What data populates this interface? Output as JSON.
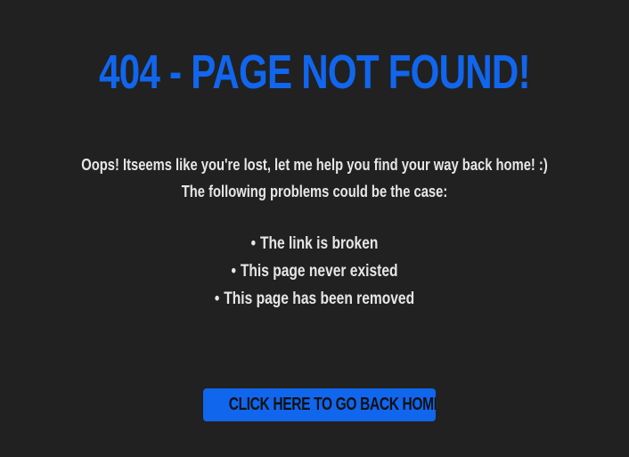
{
  "page": {
    "title": "404 - PAGE NOT FOUND!",
    "message_line_1": "Oops! Itseems like you're lost, let me help you find your way back home! :)",
    "message_line_2": "The following problems could be the case:"
  },
  "problems": [
    {
      "bullet": "•",
      "text": "The link is broken"
    },
    {
      "bullet": "•",
      "text": "This page never existed"
    },
    {
      "bullet": "•",
      "text": "This page has been removed"
    }
  ],
  "actions": {
    "home_button_label": "CLICK HERE TO GO BACK HOME"
  },
  "colors": {
    "background": "#212121",
    "accent": "#1166ee",
    "text": "#e6e6e6",
    "button_text": "#111111"
  }
}
